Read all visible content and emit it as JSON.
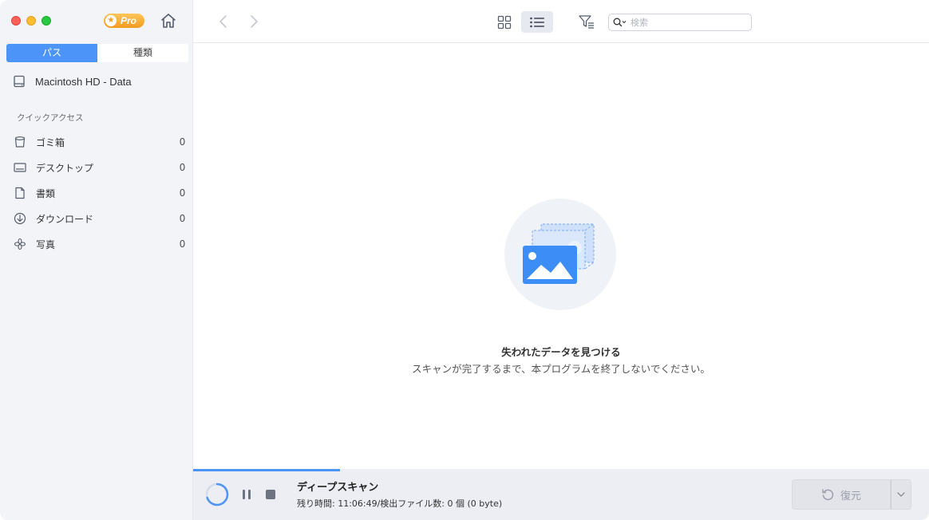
{
  "sidebar": {
    "pro_label": "Pro",
    "tabs": [
      {
        "label": "パス",
        "active": true
      },
      {
        "label": "種類",
        "active": false
      }
    ],
    "drive": {
      "label": "Macintosh HD - Data",
      "icon": "drive-icon"
    },
    "quick_access_header": "クイックアクセス",
    "quick_access": [
      {
        "label": "ゴミ箱",
        "count": "0",
        "icon": "trash-icon"
      },
      {
        "label": "デスクトップ",
        "count": "0",
        "icon": "desktop-icon"
      },
      {
        "label": "書類",
        "count": "0",
        "icon": "document-icon"
      },
      {
        "label": "ダウンロード",
        "count": "0",
        "icon": "download-icon"
      },
      {
        "label": "写真",
        "count": "0",
        "icon": "photos-icon"
      }
    ]
  },
  "toolbar": {
    "search_placeholder": "検索",
    "view_mode": "list"
  },
  "main": {
    "empty_title": "失われたデータを見つける",
    "empty_subtitle": "スキャンが完了するまで、本プログラムを終了しないでください。"
  },
  "status": {
    "progress": 0.2,
    "scan_title": "ディープスキャン",
    "scan_detail": "残り時間: 11:06:49/検出ファイル数: 0 個 (0 byte)",
    "recover_label": "復元",
    "recover_enabled": false
  },
  "colors": {
    "accent": "#4d94f8",
    "sidebar_bg": "#f3f4f8",
    "pro_badge": "#f39a1e"
  }
}
